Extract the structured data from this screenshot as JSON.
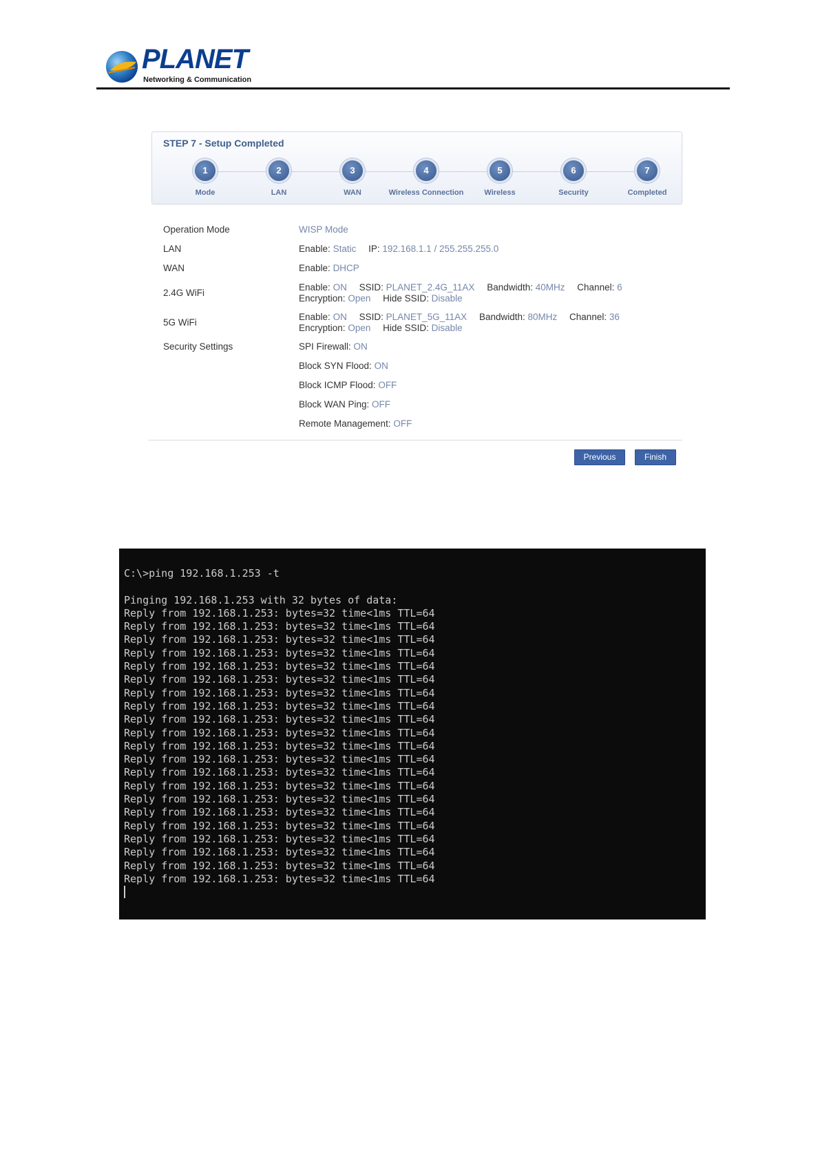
{
  "brand": {
    "name": "PLANET",
    "tagline": "Networking & Communication"
  },
  "wizard": {
    "title": "STEP 7 - Setup Completed",
    "steps": [
      {
        "number": "1",
        "label": "Mode"
      },
      {
        "number": "2",
        "label": "LAN"
      },
      {
        "number": "3",
        "label": "WAN"
      },
      {
        "number": "4",
        "label": "Wireless Connection"
      },
      {
        "number": "5",
        "label": "Wireless"
      },
      {
        "number": "6",
        "label": "Security"
      },
      {
        "number": "7",
        "label": "Completed"
      }
    ]
  },
  "summary": {
    "operation_mode": {
      "label": "Operation Mode",
      "value": "WISP Mode"
    },
    "lan": {
      "label": "LAN",
      "enable_label": "Enable:",
      "enable_value": "Static",
      "ip_label": "IP:",
      "ip_value": "192.168.1.1 / 255.255.255.0"
    },
    "wan": {
      "label": "WAN",
      "enable_label": "Enable:",
      "enable_value": "DHCP"
    },
    "wifi24": {
      "label": "2.4G WiFi",
      "enable_label": "Enable:",
      "enable_value": "ON",
      "ssid_label": "SSID:",
      "ssid_value": "PLANET_2.4G_11AX",
      "bandwidth_label": "Bandwidth:",
      "bandwidth_value": "40MHz",
      "channel_label": "Channel:",
      "channel_value": "6",
      "encryption_label": "Encryption:",
      "encryption_value": "Open",
      "hide_label": "Hide SSID:",
      "hide_value": "Disable"
    },
    "wifi5": {
      "label": "5G WiFi",
      "enable_label": "Enable:",
      "enable_value": "ON",
      "ssid_label": "SSID:",
      "ssid_value": "PLANET_5G_11AX",
      "bandwidth_label": "Bandwidth:",
      "bandwidth_value": "80MHz",
      "channel_label": "Channel:",
      "channel_value": "36",
      "encryption_label": "Encryption:",
      "encryption_value": "Open",
      "hide_label": "Hide SSID:",
      "hide_value": "Disable"
    },
    "security": {
      "label": "Security Settings",
      "items": [
        {
          "label": "SPI Firewall:",
          "value": "ON"
        },
        {
          "label": "Block SYN Flood:",
          "value": "ON"
        },
        {
          "label": "Block ICMP Flood:",
          "value": "OFF"
        },
        {
          "label": "Block WAN Ping:",
          "value": "OFF"
        },
        {
          "label": "Remote Management:",
          "value": "OFF"
        }
      ]
    }
  },
  "buttons": {
    "previous": "Previous",
    "finish": "Finish"
  },
  "terminal": {
    "command": "C:\\>ping 192.168.1.253 -t",
    "header": "Pinging 192.168.1.253 with 32 bytes of data:",
    "reply_line": "Reply from 192.168.1.253: bytes=32 time<1ms TTL=64",
    "reply_count": 21
  }
}
